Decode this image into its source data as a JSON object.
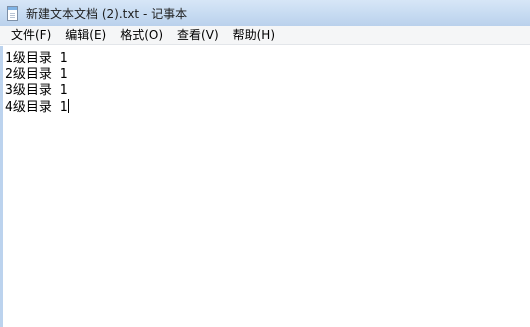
{
  "window": {
    "title": "新建文本文档 (2).txt - 记事本",
    "icon": "notepad-icon"
  },
  "menu": {
    "file": "文件(F)",
    "edit": "编辑(E)",
    "format": "格式(O)",
    "view": "查看(V)",
    "help": "帮助(H)"
  },
  "document": {
    "lines": [
      "1级目录 1",
      "2级目录 1",
      "3级目录 1",
      "4级目录 1"
    ]
  }
}
